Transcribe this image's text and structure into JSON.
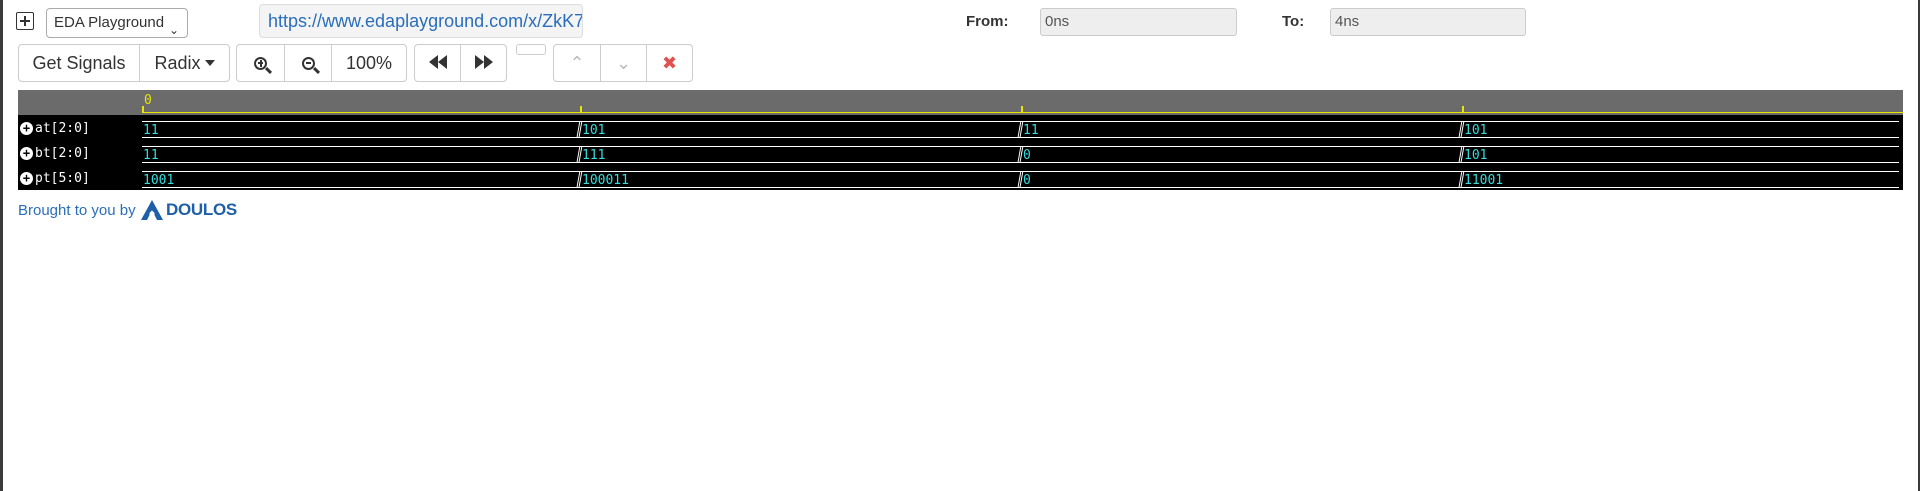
{
  "header": {
    "select_value": "EDA Playground",
    "url": "https://www.edaplayground.com/x/ZkK7",
    "from_label": "From:",
    "from_value": "0ns",
    "to_label": "To:",
    "to_value": "4ns"
  },
  "toolbar": {
    "get_signals_label": "Get Signals",
    "radix_label": "Radix",
    "zoom_level": "100%"
  },
  "waveform": {
    "ruler_start_label": "0",
    "signals": [
      {
        "name": "at[2:0]",
        "values": [
          "11",
          "101",
          "11",
          "101"
        ]
      },
      {
        "name": "bt[2:0]",
        "values": [
          "11",
          "111",
          "0",
          "101"
        ]
      },
      {
        "name": "pt[5:0]",
        "values": [
          "1001",
          "100011",
          "0",
          "11001"
        ]
      }
    ]
  },
  "footer": {
    "brought_text": "Brought to you by",
    "logo_text": "DOULOS"
  },
  "colors": {
    "wave_value": "#33dddd",
    "ruler": "#e6e600",
    "link": "#2a6ebb"
  }
}
